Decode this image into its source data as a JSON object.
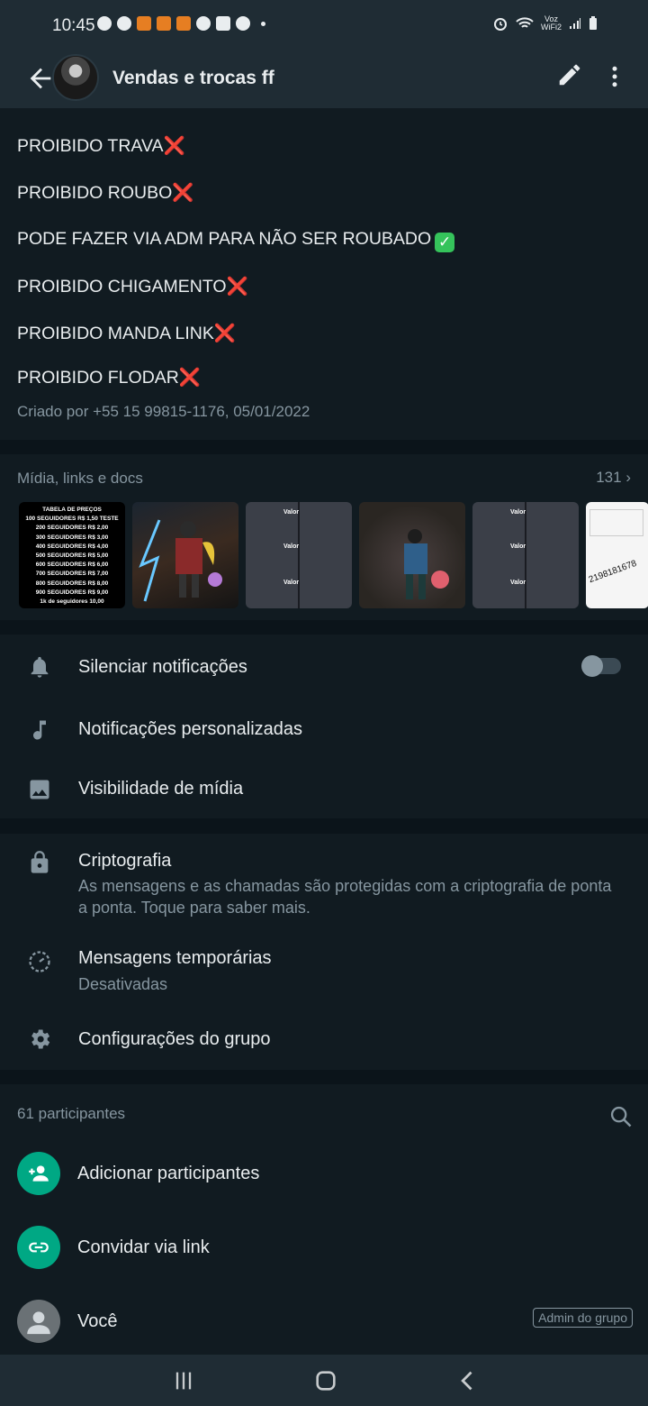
{
  "status_bar": {
    "time": "10:45",
    "voz_top": "Voz",
    "voz_bottom": "WiFi2"
  },
  "app_bar": {
    "title": "Vendas e trocas ff"
  },
  "description": {
    "lines": [
      "PROIBIDO TRAVA",
      "PROIBIDO ROUBO",
      "PODE FAZER VIA ADM PARA NÃO SER ROUBADO",
      "PROIBIDO CHIGAMENTO",
      "PROIBIDO MANDA LINK",
      "PROIBIDO FLODAR"
    ],
    "cross_mark": "❌",
    "check_mark": "✓",
    "created": "Criado por +55 15 99815-1176, 05/01/2022"
  },
  "media": {
    "title": "Mídia, links e docs",
    "count": "131",
    "price_table": {
      "header": "TABELA DE PREÇOS",
      "rows": [
        "100 SEGUIDORES R$ 1,50  TESTE",
        "200 SEGUIDORES R$ 2,00",
        "300 SEGUIDORES R$ 3,00",
        "400 SEGUIDORES R$ 4,00",
        "500 SEGUIDORES R$ 5,00",
        "600 SEGUIDORES R$ 6,00",
        "700 SEGUIDORES R$ 7,00",
        "800 SEGUIDORES R$ 8,00",
        "900  SEGUIDORES R$ 9,00",
        "1k de seguidores 10,00"
      ]
    },
    "grid_labels": [
      "Valor",
      "Valor",
      "Valor",
      "Valor",
      "Valor",
      "Valor"
    ],
    "thumb6_text": "2198181678"
  },
  "notifications": {
    "mute": "Silenciar notificações",
    "custom": "Notificações personalizadas",
    "media_visibility": "Visibilidade de mídia"
  },
  "security": {
    "encryption_title": "Criptografia",
    "encryption_sub": "As mensagens e as chamadas são protegidas com a criptografia de ponta a ponta. Toque para saber mais.",
    "temp_title": "Mensagens temporárias",
    "temp_sub": "Desativadas",
    "group_settings": "Configurações do grupo"
  },
  "members": {
    "title": "61 participantes",
    "add": "Adicionar participantes",
    "invite": "Convidar via link",
    "you": "Você",
    "admin_badge": "Admin do grupo"
  },
  "colors": {
    "accent": "#00a884",
    "bg": "#0b141a",
    "card": "#111b21",
    "bar": "#1f2c34",
    "cross": "#e0303c"
  },
  "icons": [
    "arrow-back-icon",
    "pencil-icon",
    "more-vert-icon",
    "bell-icon",
    "music-note-icon",
    "image-icon",
    "lock-icon",
    "timer-icon",
    "gear-icon",
    "search-icon",
    "add-person-icon",
    "link-icon",
    "person-icon"
  ]
}
